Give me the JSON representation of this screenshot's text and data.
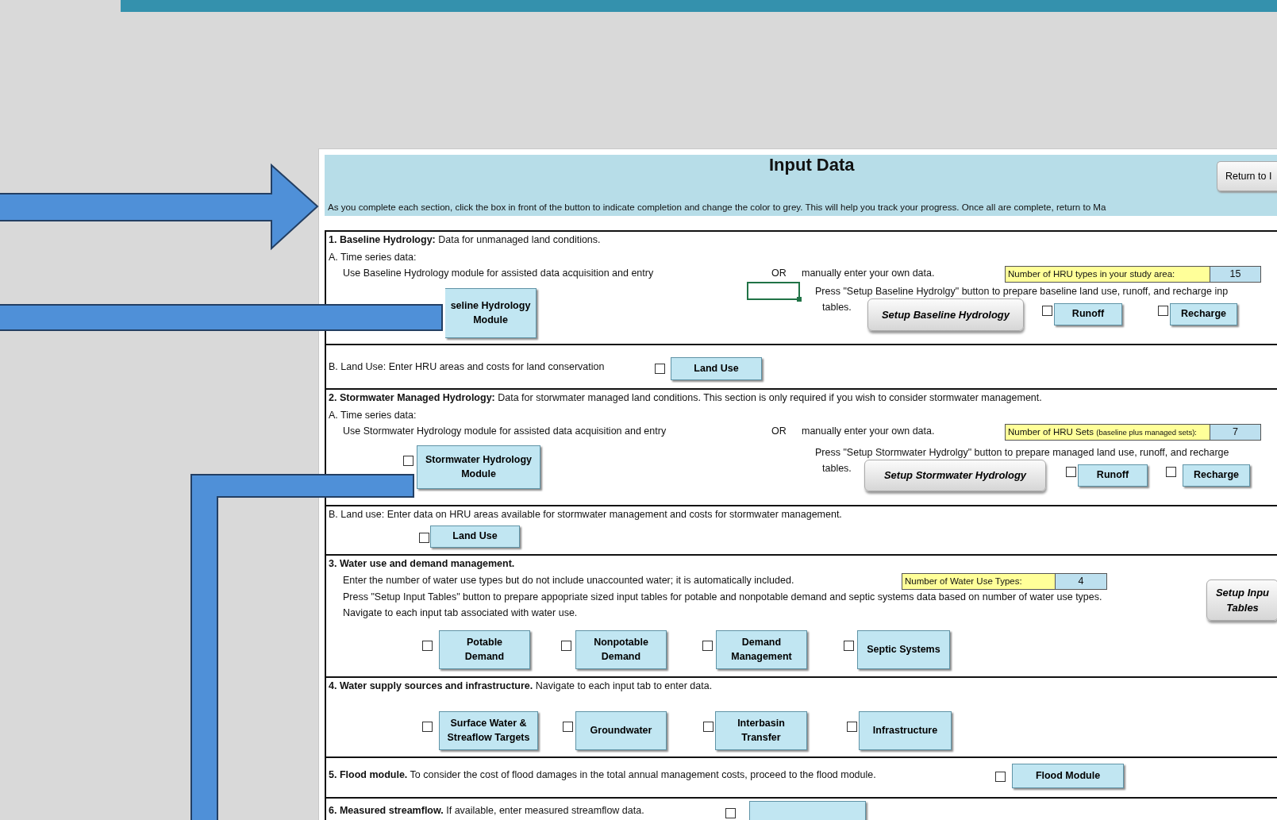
{
  "sheet": {
    "title": "Input Data",
    "return_button": "Return to I",
    "instructions": "As you complete each section, click the box in front of the button to indicate completion and change the color to grey. This will help you track your progress. Once all are complete, return to Ma"
  },
  "sections": [
    {
      "heading": "**1. Baseline Hydrology:** Data for unmanaged land conditions.",
      "subheading": "A. Time series data:",
      "module_text": "Use Baseline Hydrology module for assisted data acquisition and entry",
      "or": "OR",
      "manual_text": "manually enter your own data.",
      "count_label": "Number of HRU types in your study area:",
      "count_value": "15",
      "setup_text": "Press \"Setup Baseline Hydrolgy\" button to prepare baseline land use, runoff, and recharge inp",
      "setup_text_2": "tables.",
      "module_button": {
        "label_lines": [
          "seline Hydrology",
          "Module"
        ]
      },
      "setup_button": "Setup Baseline Hydrology",
      "tables": [
        {
          "label": "Runoff",
          "checked": false
        },
        {
          "label": "Recharge",
          "checked": false
        }
      ],
      "land_use": {
        "text": "B. Land Use: Enter HRU areas and costs for land conservation",
        "button": "Land Use",
        "checked": false
      }
    },
    {
      "heading": "**2. Stormwater Managed Hydrology:** Data for storwmater managed land conditions. This section is only required if you wish to consider stormwater management.",
      "subheading": "A. Time series data:",
      "module_text": "Use Stormwater Hydrology module for assisted data acquisition and entry",
      "or": "OR",
      "manual_text": "manually enter your own data.",
      "count_label": "Number of HRU Sets",
      "count_note": "(baseline plus managed sets):",
      "count_value": "7",
      "setup_text": "Press \"Setup Stormwater Hydrolgy\" button to prepare managed land use, runoff, and recharge",
      "setup_text_2": "tables.",
      "module_button": {
        "label_lines": [
          "Stormwater Hydrology",
          "Module"
        ],
        "checked": false
      },
      "setup_button": "Setup Stormwater Hydrology",
      "tables": [
        {
          "label": "Runoff",
          "checked": false
        },
        {
          "label": "Recharge",
          "checked": false
        }
      ],
      "land_use": {
        "text": "B. Land use: Enter data on HRU areas available for stormwater management and costs for stormwater management.",
        "button": "Land Use",
        "checked": false
      }
    },
    {
      "heading": "3. Water use and demand management.",
      "lines": [
        "Enter the number of water use types but do not include unaccounted water; it is automatically included.",
        "Press \"Setup Input Tables\" button to prepare appopriate sized input tables for potable and nonpotable demand and septic systems data based on number of water use types.",
        "Navigate to each input tab associated with water use."
      ],
      "count_label": "Number of Water Use Types:",
      "count_value": "4",
      "setup_button_lines": [
        "Setup Inpu",
        "Tables"
      ],
      "items": [
        {
          "label_lines": [
            "Potable",
            "Demand"
          ],
          "checked": false
        },
        {
          "label_lines": [
            "Nonpotable",
            "Demand"
          ],
          "checked": false
        },
        {
          "label_lines": [
            "Demand",
            "Management"
          ],
          "checked": false
        },
        {
          "label_lines": [
            "Septic  Systems"
          ],
          "checked": false
        }
      ]
    },
    {
      "heading": "**4. Water supply sources and infrastructure.** Navigate to each input tab to enter data.",
      "items": [
        {
          "label_lines": [
            "Surface Water &",
            "Streaflow Targets"
          ],
          "checked": false
        },
        {
          "label_lines": [
            "Groundwater"
          ],
          "checked": false
        },
        {
          "label_lines": [
            "Interbasin",
            "Transfer"
          ],
          "checked": false
        },
        {
          "label_lines": [
            "Infrastructure"
          ],
          "checked": false
        }
      ]
    },
    {
      "heading": "**5. Flood module.** To consider the cost of flood damages in the total annual management costs, proceed to the flood module.",
      "items": [
        {
          "label_lines": [
            "Flood Module"
          ],
          "checked": false
        }
      ]
    },
    {
      "heading": "**6. Measured streamflow.** If available, enter measured streamflow data.",
      "items": [
        {
          "checked": false
        }
      ]
    }
  ]
}
